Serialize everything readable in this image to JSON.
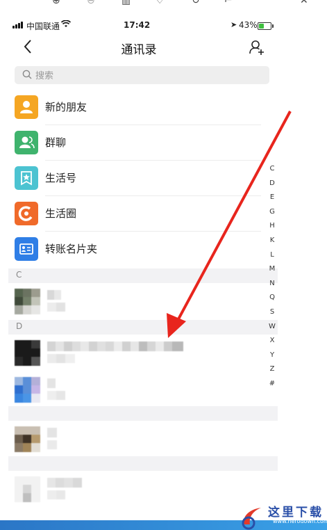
{
  "status_bar": {
    "carrier": "中国联通",
    "time": "17:42",
    "battery": "43%",
    "battery_level": 0.43
  },
  "nav": {
    "title": "通讯录",
    "back_icon": "chevron-left-icon",
    "add_icon": "add-friend-icon"
  },
  "search": {
    "placeholder": "搜索"
  },
  "menu": [
    {
      "label": "新的朋友",
      "icon": "person-icon",
      "color": "#f5a623"
    },
    {
      "label": "群聊",
      "icon": "group-icon",
      "color": "#3fb36d"
    },
    {
      "label": "生活号",
      "icon": "star-bookmark-icon",
      "color": "#4cc3d1"
    },
    {
      "label": "生活圈",
      "icon": "ring-icon",
      "color": "#f06a2a"
    },
    {
      "label": "转账名片夹",
      "icon": "card-icon",
      "color": "#2f7ee6"
    }
  ],
  "sections": [
    "C",
    "D",
    "",
    "",
    ""
  ],
  "index_letters": [
    "C",
    "D",
    "E",
    "G",
    "H",
    "K",
    "L",
    "M",
    "N",
    "Q",
    "S",
    "W",
    "X",
    "Y",
    "Z",
    "#"
  ],
  "watermark": {
    "text": "这里下载",
    "url": "www.herodown.com"
  }
}
